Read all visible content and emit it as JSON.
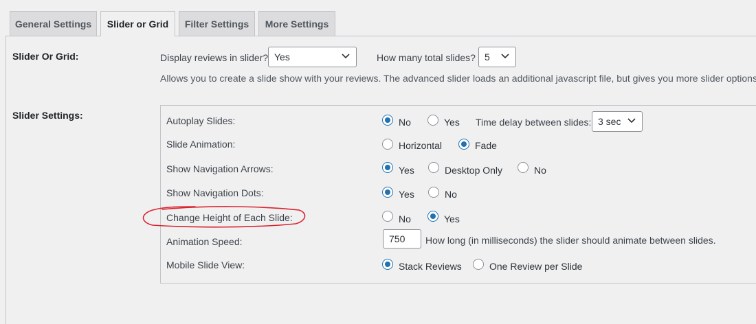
{
  "tabs": [
    "General Settings",
    "Slider or Grid",
    "Filter Settings",
    "More Settings"
  ],
  "slider_or_grid": {
    "label": "Slider Or Grid:",
    "display_prompt": "Display reviews in slider?",
    "display_value": "Yes",
    "total_prompt": "How many total slides?",
    "total_value": "5",
    "description": "Allows you to create a slide show with your reviews. The advanced slider loads an additional javascript file, but gives you more slider options."
  },
  "slider_settings": {
    "label": "Slider Settings:",
    "autoplay": {
      "label": "Autoplay Slides:",
      "options": [
        "No",
        "Yes"
      ],
      "selected": "No",
      "delay_label": "Time delay between slides:",
      "delay_value": "3 sec"
    },
    "animation": {
      "label": "Slide Animation:",
      "options": [
        "Horizontal",
        "Fade"
      ],
      "selected": "Fade"
    },
    "arrows": {
      "label": "Show Navigation Arrows:",
      "options": [
        "Yes",
        "Desktop Only",
        "No"
      ],
      "selected": "Yes"
    },
    "dots": {
      "label": "Show Navigation Dots:",
      "options": [
        "Yes",
        "No"
      ],
      "selected": "Yes"
    },
    "height": {
      "label": "Change Height of Each Slide:",
      "options": [
        "No",
        "Yes"
      ],
      "selected": "Yes"
    },
    "speed": {
      "label": "Animation Speed:",
      "value": "750",
      "help": "How long (in milliseconds) the slider should animate between slides."
    },
    "mobile": {
      "label": "Mobile Slide View:",
      "options": [
        "Stack Reviews",
        "One Review per Slide"
      ],
      "selected": "Stack Reviews"
    }
  },
  "colors": {
    "accent": "#2271b1",
    "annotation": "#d9232e"
  }
}
